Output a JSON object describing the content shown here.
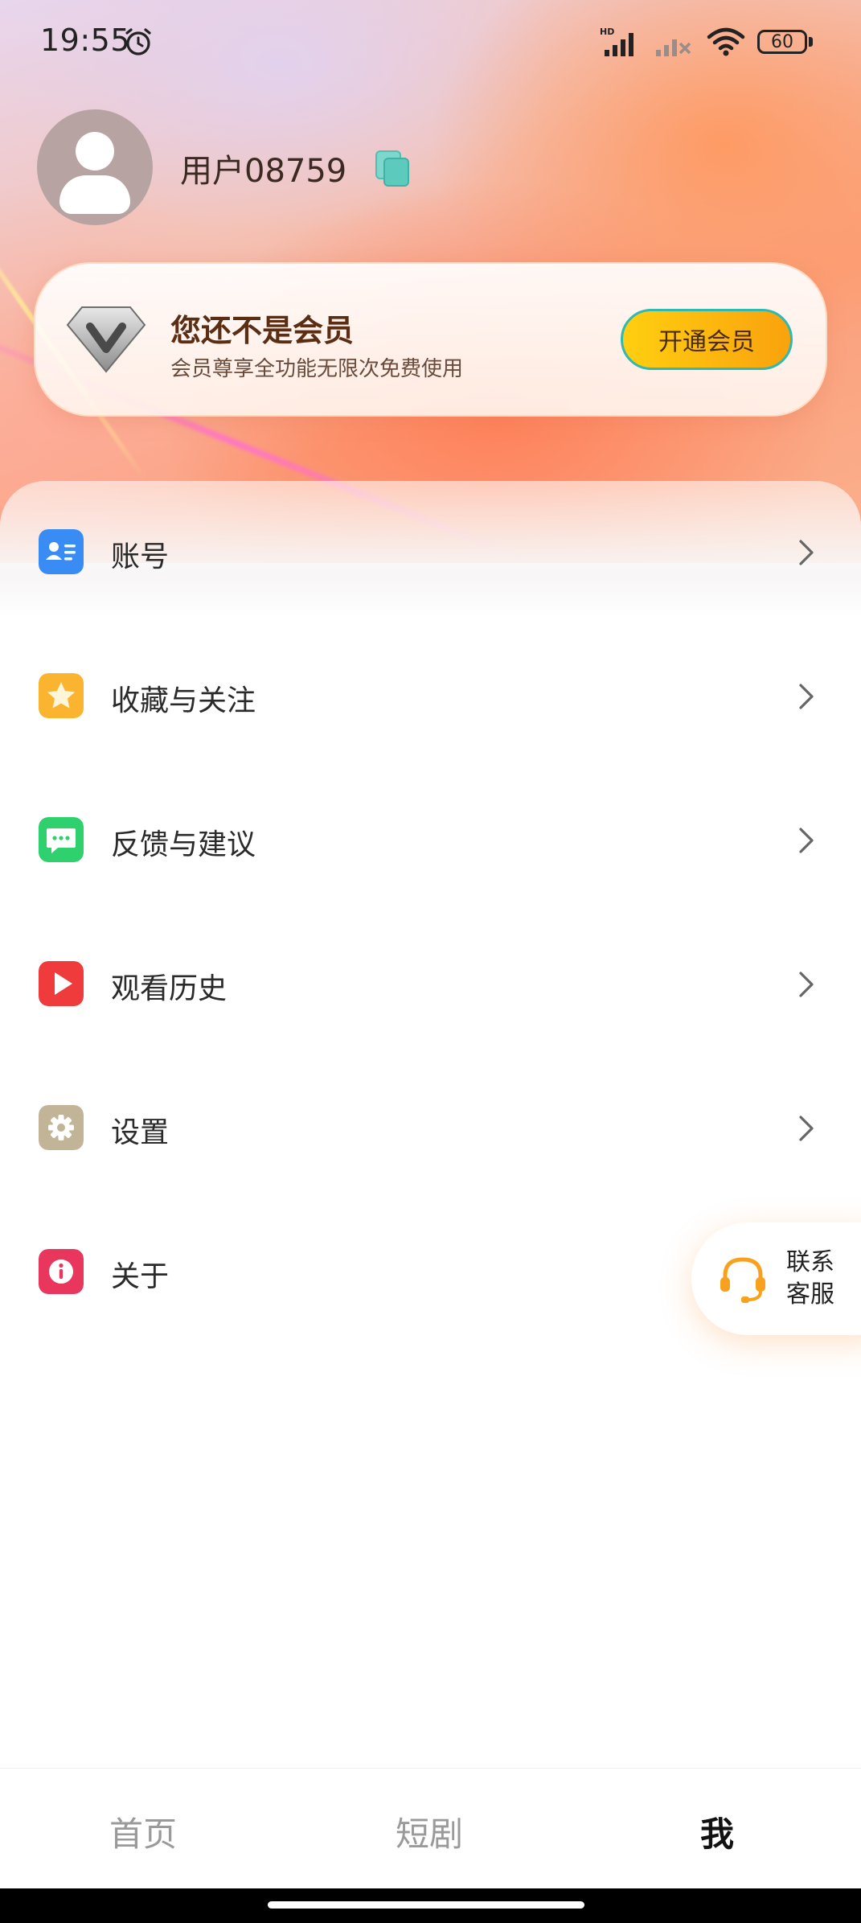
{
  "status_bar": {
    "time": "19:55",
    "battery": "60",
    "icons": [
      "alarm-icon",
      "hd-signal-icon",
      "signal-no-service-icon",
      "wifi-icon",
      "battery-icon"
    ]
  },
  "profile": {
    "username": "用户08759",
    "avatar_icon": "default-avatar-icon",
    "copy_icon": "copy-icon"
  },
  "vip_card": {
    "title": "您还不是会员",
    "subtitle": "会员尊享全功能无限次免费使用",
    "button_label": "开通会员",
    "icon": "diamond-v-icon"
  },
  "menu": {
    "items": [
      {
        "label": "账号",
        "icon": "account-card-icon",
        "color": "#3a8cf5"
      },
      {
        "label": "收藏与关注",
        "icon": "star-icon",
        "color": "#fbb42f"
      },
      {
        "label": "反馈与建议",
        "icon": "chat-bubble-icon",
        "color": "#2fd16f"
      },
      {
        "label": "观看历史",
        "icon": "play-icon",
        "color": "#ef3b3b"
      },
      {
        "label": "设置",
        "icon": "gear-icon",
        "color": "#c2b497"
      },
      {
        "label": "关于",
        "icon": "info-icon",
        "color": "#e8365c"
      }
    ]
  },
  "customer_service": {
    "label": "联系客服",
    "icon": "headset-icon",
    "color": "#f7a11f"
  },
  "bottom_nav": {
    "tabs": [
      {
        "label": "首页",
        "active": false
      },
      {
        "label": "短剧",
        "active": false
      },
      {
        "label": "我",
        "active": true
      }
    ]
  }
}
